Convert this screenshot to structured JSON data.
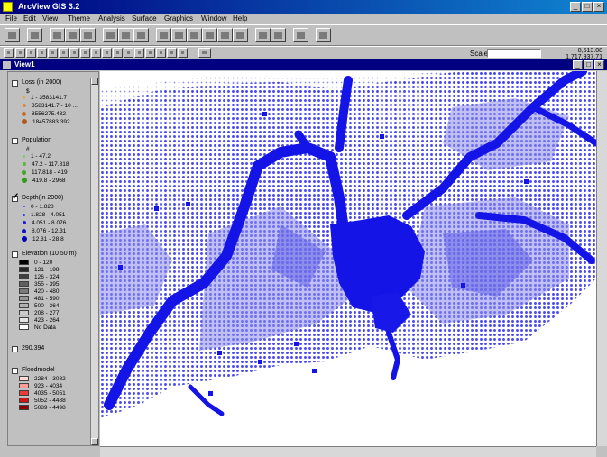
{
  "app": {
    "title": "ArcView GIS 3.2"
  },
  "menu": [
    "File",
    "Edit",
    "View",
    "Theme",
    "Analysis",
    "Surface",
    "Graphics",
    "Window",
    "Help"
  ],
  "toolbar": {
    "scale_label": "Scale 1:",
    "scale_value": "",
    "coord_x": "8,513.08",
    "coord_y": "1,717,937.71"
  },
  "view": {
    "title": "View1"
  },
  "toc": [
    {
      "name": "Loss (in 2000)",
      "checked": false,
      "header": "$",
      "items": [
        {
          "label": "1 - 3583141.7",
          "color": "#f0a050",
          "size": 3
        },
        {
          "label": "3583141.7 - 10 ...",
          "color": "#e08a3a",
          "size": 4
        },
        {
          "label": "8556275.482",
          "color": "#c86c28",
          "size": 5
        },
        {
          "label": "18457883.392",
          "color": "#b05a20",
          "size": 6
        }
      ]
    },
    {
      "name": "Population",
      "checked": false,
      "header": "#",
      "items": [
        {
          "label": "1 - 47.2",
          "color": "#7ccc5c",
          "size": 3
        },
        {
          "label": "47.2 - 117.818",
          "color": "#5ab83a",
          "size": 4
        },
        {
          "label": "117.818 - 419",
          "color": "#3ea822",
          "size": 5
        },
        {
          "label": "419.8 - 2968",
          "color": "#28a010",
          "size": 6
        }
      ]
    },
    {
      "name": "Depth(in 2000)",
      "checked": true,
      "header": "",
      "items": [
        {
          "label": "0 - 1.828",
          "color": "#4040ff",
          "size": 2
        },
        {
          "label": "1.828 - 4.051",
          "color": "#3030ee",
          "size": 3
        },
        {
          "label": "4.051 - 8.076",
          "color": "#2020dd",
          "size": 4
        },
        {
          "label": "8.076 - 12.31",
          "color": "#1010cc",
          "size": 5
        },
        {
          "label": "12.31 - 28.8",
          "color": "#0000bb",
          "size": 6
        }
      ]
    },
    {
      "name": "Elevation (10 50 m)",
      "checked": false,
      "header": "",
      "items": [
        {
          "label": "0 - 120",
          "color": "#000000"
        },
        {
          "label": "121 - 199",
          "color": "#262626"
        },
        {
          "label": "126 - 324",
          "color": "#404040"
        },
        {
          "label": "355 - 395",
          "color": "#606060"
        },
        {
          "label": "420 - 480",
          "color": "#7a7a7a"
        },
        {
          "label": "481 - 590",
          "color": "#959595"
        },
        {
          "label": "500 - 364",
          "color": "#b0b0b0"
        },
        {
          "label": "208 - 277",
          "color": "#cacaca"
        },
        {
          "label": "423 - 264",
          "color": "#e4e4e4"
        },
        {
          "label": "No Data",
          "color": "#ffffff"
        }
      ]
    },
    {
      "name": "290.394",
      "checked": false,
      "header": "",
      "items": []
    },
    {
      "name": "Floodmodel",
      "checked": false,
      "header": "",
      "items": [
        {
          "label": "2284 - 3082",
          "color": "#ffd8d8"
        },
        {
          "label": "923 - 4034",
          "color": "#ff9a9a"
        },
        {
          "label": "4035 - 5051",
          "color": "#ee3a3a"
        },
        {
          "label": "5052 - 4488",
          "color": "#c81818"
        },
        {
          "label": "5089 - 4498",
          "color": "#8a0000"
        }
      ]
    }
  ],
  "colors": {
    "flood": "#1414e6",
    "flood_light": "#9a9aef",
    "titlebar": "#000080"
  }
}
